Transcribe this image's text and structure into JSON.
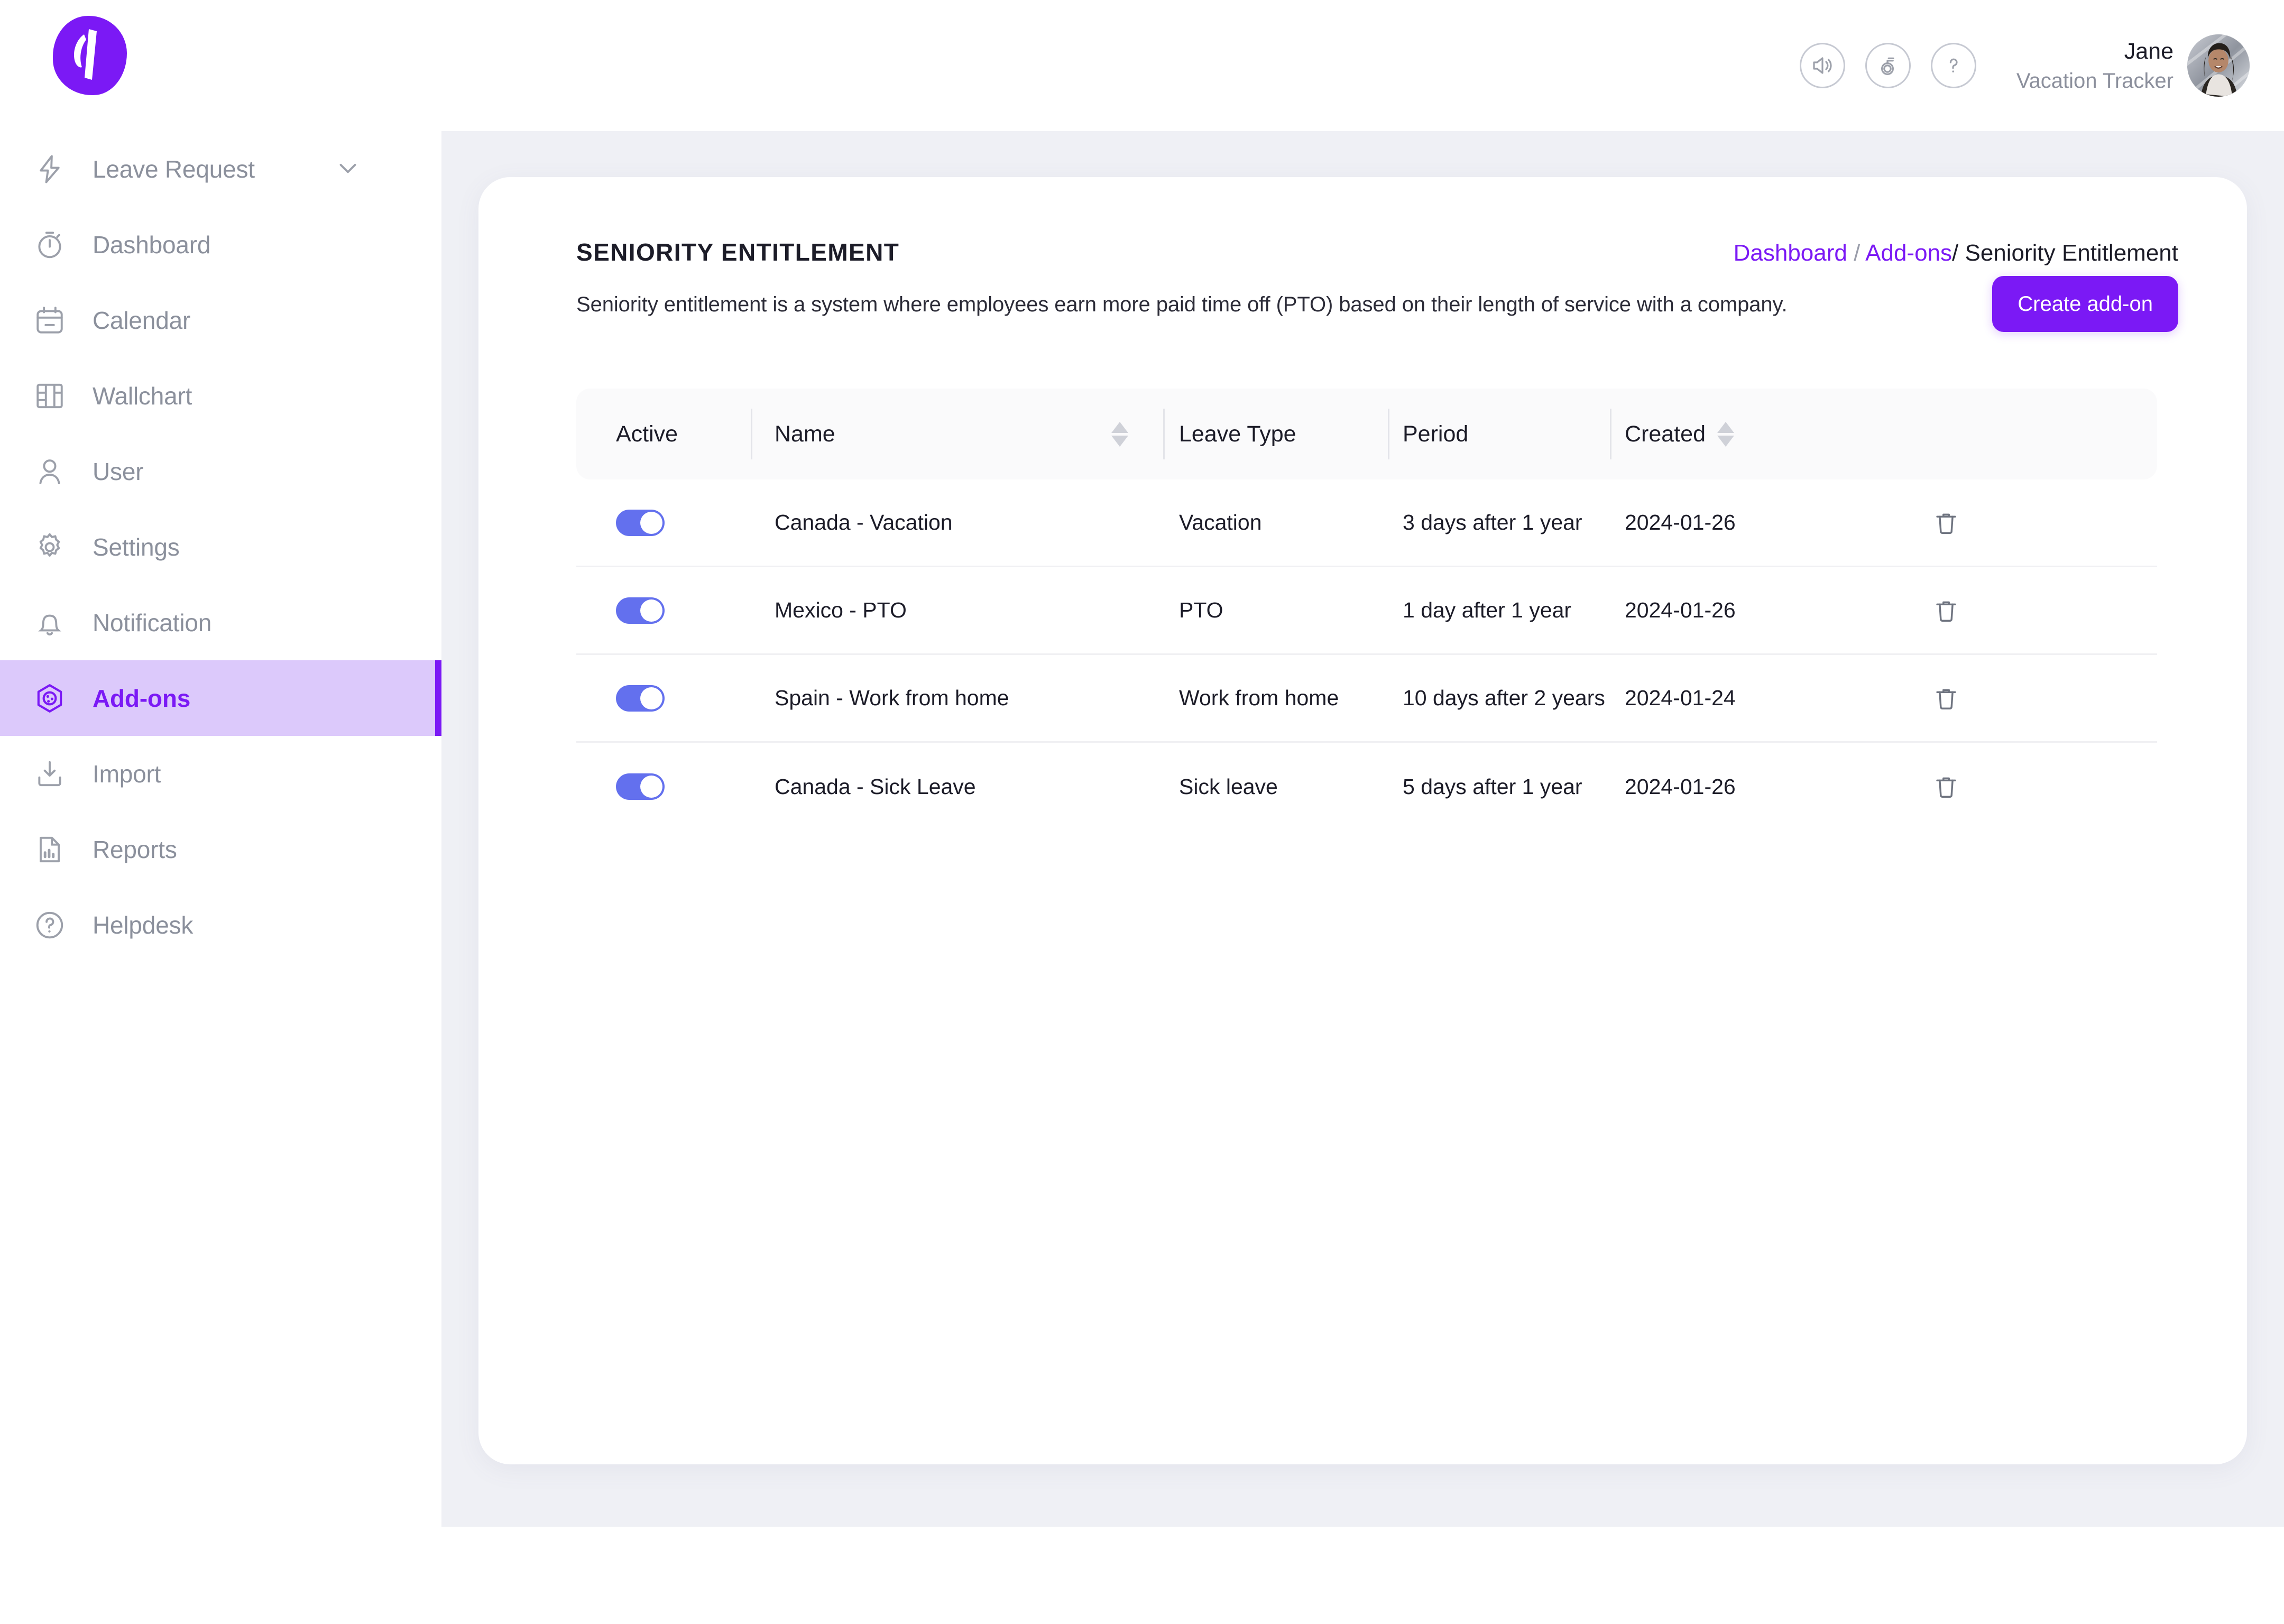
{
  "brand": {
    "logo_letter": "V",
    "accent_purple": "#7B19F5",
    "toggle_blue": "#6370EE",
    "highlight_lavender": "#DCC9FB",
    "content_bg": "#EFF0F5"
  },
  "topbar": {
    "icons": [
      {
        "name": "announcement-speaker-icon",
        "label": "Announcements"
      },
      {
        "name": "whats-new-badge-icon",
        "label": "What's new"
      },
      {
        "name": "help-question-icon",
        "label": "Help"
      }
    ],
    "user": {
      "name": "Jane",
      "role": "Vacation Tracker",
      "avatar": "user-avatar"
    }
  },
  "sidebar": {
    "items": [
      {
        "label": "Leave Request",
        "icon": "bolt-icon",
        "active": false,
        "has_chevron": true
      },
      {
        "label": "Dashboard",
        "icon": "stopwatch-icon",
        "active": false,
        "has_chevron": false
      },
      {
        "label": "Calendar",
        "icon": "calendar-icon",
        "active": false,
        "has_chevron": false
      },
      {
        "label": "Wallchart",
        "icon": "wallchart-icon",
        "active": false,
        "has_chevron": false
      },
      {
        "label": "User",
        "icon": "user-icon",
        "active": false,
        "has_chevron": false
      },
      {
        "label": "Settings",
        "icon": "gear-icon",
        "active": false,
        "has_chevron": false
      },
      {
        "label": "Notification",
        "icon": "bell-icon",
        "active": false,
        "has_chevron": false
      },
      {
        "label": "Add-ons",
        "icon": "addons-hex-icon",
        "active": true,
        "has_chevron": false
      },
      {
        "label": "Import",
        "icon": "import-down-icon",
        "active": false,
        "has_chevron": false
      },
      {
        "label": "Reports",
        "icon": "reports-doc-icon",
        "active": false,
        "has_chevron": false
      },
      {
        "label": "Helpdesk",
        "icon": "helpdesk-question-icon",
        "active": false,
        "has_chevron": false
      }
    ]
  },
  "main": {
    "title": "SENIORITY ENTITLEMENT",
    "description": "Seniority entitlement is a system where employees earn more paid time off (PTO) based on their length of service with a company.",
    "create_button": "Create add-on",
    "breadcrumb": {
      "items": [
        "Dashboard",
        "Add-ons",
        "Seniority Entitlement"
      ],
      "sep1": " / ",
      "sep2": "/ "
    },
    "table": {
      "columns": [
        {
          "key": "active",
          "label": "Active",
          "sortable": false
        },
        {
          "key": "name",
          "label": "Name",
          "sortable": true
        },
        {
          "key": "type",
          "label": "Leave Type",
          "sortable": false
        },
        {
          "key": "period",
          "label": "Period",
          "sortable": false
        },
        {
          "key": "created",
          "label": "Created",
          "sortable": true
        }
      ],
      "rows": [
        {
          "active": true,
          "name": "Canada - Vacation",
          "type": "Vacation",
          "period": "3 days after 1 year",
          "created": "2024-01-26",
          "delete_icon": "trash-icon"
        },
        {
          "active": true,
          "name": "Mexico - PTO",
          "type": "PTO",
          "period": "1 day after 1 year",
          "created": "2024-01-26",
          "delete_icon": "trash-icon"
        },
        {
          "active": true,
          "name": "Spain - Work from home",
          "type": "Work from home",
          "period": "10 days after 2 years",
          "created": "2024-01-24",
          "delete_icon": "trash-icon"
        },
        {
          "active": true,
          "name": "Canada - Sick Leave",
          "type": "Sick leave",
          "period": "5 days after 1 year",
          "created": "2024-01-26",
          "delete_icon": "trash-icon"
        }
      ]
    }
  }
}
